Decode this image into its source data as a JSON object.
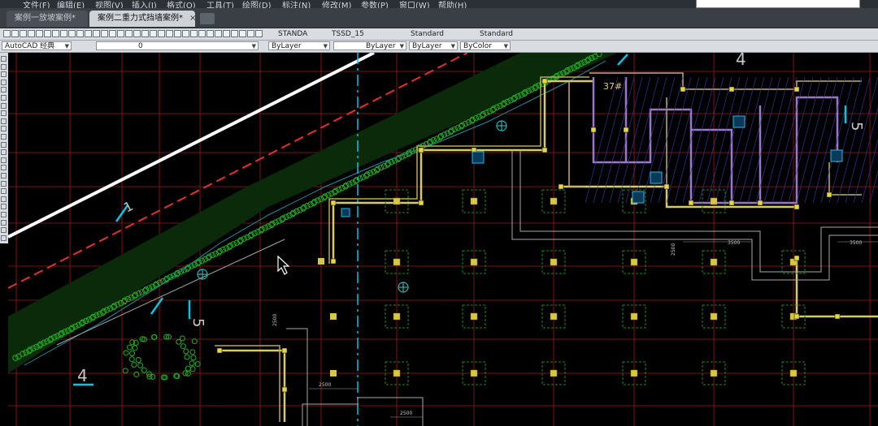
{
  "menu": {
    "items": [
      "文件(F)",
      "编辑(E)",
      "视图(V)",
      "插入(I)",
      "格式(O)",
      "工具(T)",
      "绘图(D)",
      "标注(N)",
      "修改(M)",
      "参数(P)",
      "窗口(W)",
      "帮助(H)"
    ]
  },
  "tabs": [
    {
      "label": "案例一放坡案例*",
      "active": false
    },
    {
      "label": "案例二重力式挡墙案例*",
      "active": true,
      "close": "×"
    }
  ],
  "toolbar": {
    "styles": {
      "text_style": "STANDA",
      "dim_style": "TSSD_15",
      "table_style": "Standard",
      "mleader_style": "Standard"
    },
    "workspace": "AutoCAD 经典",
    "layer": "0",
    "properties": {
      "color": "ByLayer",
      "linetype": "ByLayer",
      "lineweight": "ByLayer",
      "plotstyle": "ByColor"
    }
  },
  "drawing": {
    "labels": {
      "section_one": "1",
      "section_five_left": "5",
      "section_four_left": "4",
      "section_four_top": "4",
      "section_five_right": "5",
      "room_label": "37#"
    },
    "dimensions": {
      "d1": "2500",
      "d2": "2500",
      "d3": "3500",
      "d4": "2500",
      "d5": "2500",
      "d6": "3500"
    },
    "colors": {
      "background": "#000000",
      "grid_red": "#9b1a1a",
      "dashed_red": "#e53030",
      "green_piles": "#1fb01f",
      "yellow_beam": "#d8cc60",
      "cyan_axis": "#00c6e6",
      "purple_wall": "#9a77c8",
      "white_edge": "#ffffff"
    }
  }
}
